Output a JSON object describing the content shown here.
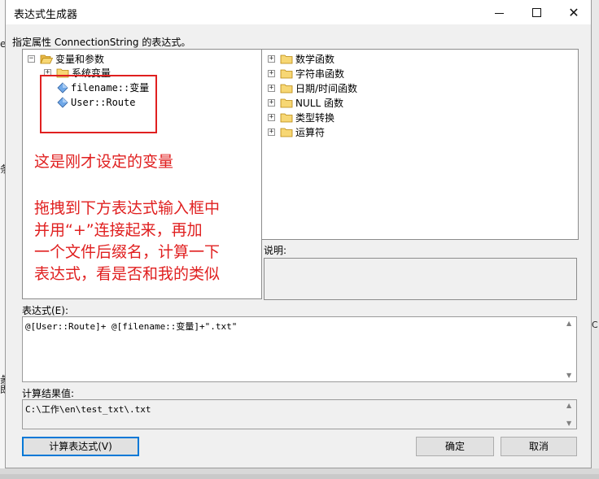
{
  "window": {
    "title": "表达式生成器"
  },
  "prompt": "指定属性 ConnectionString 的表达式。",
  "left_tree": {
    "root_label": "变量和参数",
    "system_vars_label": "系统变量",
    "variables": [
      "filename::变量",
      "User::Route"
    ]
  },
  "right_tree": {
    "items": [
      "数学函数",
      "字符串函数",
      "日期/时间函数",
      "NULL 函数",
      "类型转换",
      "运算符"
    ]
  },
  "annotation": {
    "line1": "这是刚才设定的变量",
    "line2": "拖拽到下方表达式输入框中",
    "line3": "并用“+”连接起来，再加",
    "line4": "一个文件后缀名，计算一下",
    "line5": "表达式，看是否和我的类似"
  },
  "description": {
    "label": "说明:"
  },
  "expression": {
    "label": "表达式(E):",
    "value": "@[User::Route]+ @[filename::变量]+\".txt\""
  },
  "result": {
    "label": "计算结果值:",
    "value": "C:\\工作\\en\\test_txt\\.txt"
  },
  "buttons": {
    "evaluate": "计算表达式(V)",
    "ok": "确定",
    "cancel": "取消"
  },
  "background": {
    "left_chars": [
      "e",
      "条",
      "彖",
      "即"
    ],
    "right_char": "C"
  },
  "colors": {
    "annotation_red": "#e02020",
    "focus_blue": "#0078d7"
  }
}
